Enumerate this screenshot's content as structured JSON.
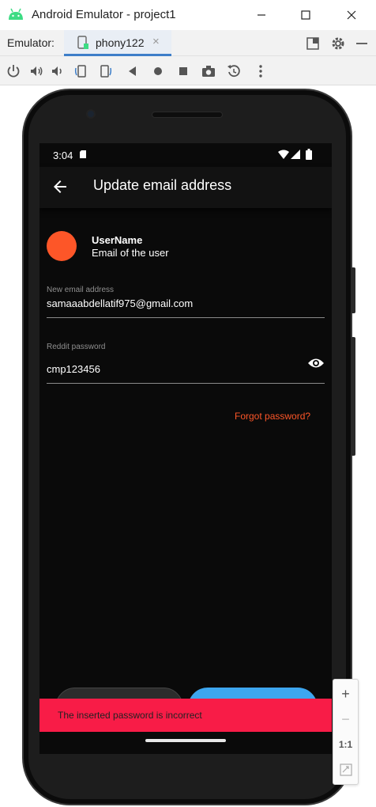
{
  "window": {
    "title": "Android Emulator - project1"
  },
  "tabbar": {
    "label": "Emulator:",
    "device_tab": "phony122",
    "close_glyph": "×"
  },
  "toolbar": {
    "icons": [
      "power-icon",
      "volume-up-icon",
      "volume-down-icon",
      "rotate-left-icon",
      "rotate-right-icon",
      "back-icon",
      "home-icon",
      "overview-icon",
      "camera-icon",
      "replay-icon",
      "more-icon"
    ]
  },
  "phone": {
    "status": {
      "time": "3:04"
    },
    "appbar": {
      "title": "Update email address"
    },
    "user": {
      "name": "UserName",
      "email": "Email of the user"
    },
    "email_field": {
      "label": "New email address",
      "value": "samaaabdellatif975@gmail.com"
    },
    "password_field": {
      "label": "Reddit password",
      "value": "cmp123456"
    },
    "forgot": "Forgot password?",
    "snackbar": "The inserted password is incorrect"
  },
  "zoom": {
    "plus": "+",
    "minus": "−",
    "one_to_one": "1:1"
  },
  "colors": {
    "accent": "#fd5628",
    "snackbar": "#f81c47",
    "primary_button": "#3da6ef",
    "tab_underline": "#3d7ec9"
  }
}
